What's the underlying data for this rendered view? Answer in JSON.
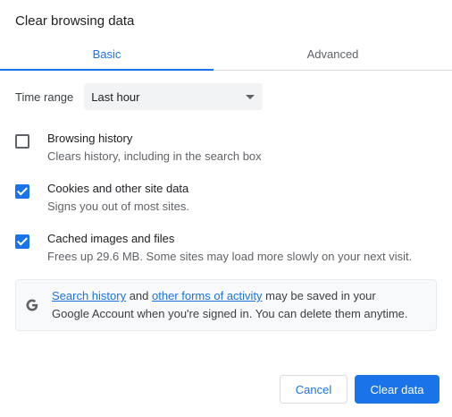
{
  "dialog": {
    "title": "Clear browsing data"
  },
  "tabs": [
    {
      "label": "Basic",
      "active": true
    },
    {
      "label": "Advanced",
      "active": false
    }
  ],
  "time_range": {
    "label": "Time range",
    "selected": "Last hour"
  },
  "options": [
    {
      "title": "Browsing history",
      "description": "Clears history, including in the search box",
      "checked": false
    },
    {
      "title": "Cookies and other site data",
      "description": "Signs you out of most sites.",
      "checked": true
    },
    {
      "title": "Cached images and files",
      "description": "Frees up 29.6 MB. Some sites may load more slowly on your next visit.",
      "checked": true
    }
  ],
  "info": {
    "icon": "google-g-icon",
    "link1": "Search history",
    "text1": " and ",
    "link2": "other forms of activity",
    "text2": " may be saved in your",
    "line2": "Google Account when you're signed in. You can delete them anytime."
  },
  "buttons": {
    "cancel": "Cancel",
    "clear": "Clear data"
  },
  "colors": {
    "accent": "#1a73e8"
  }
}
